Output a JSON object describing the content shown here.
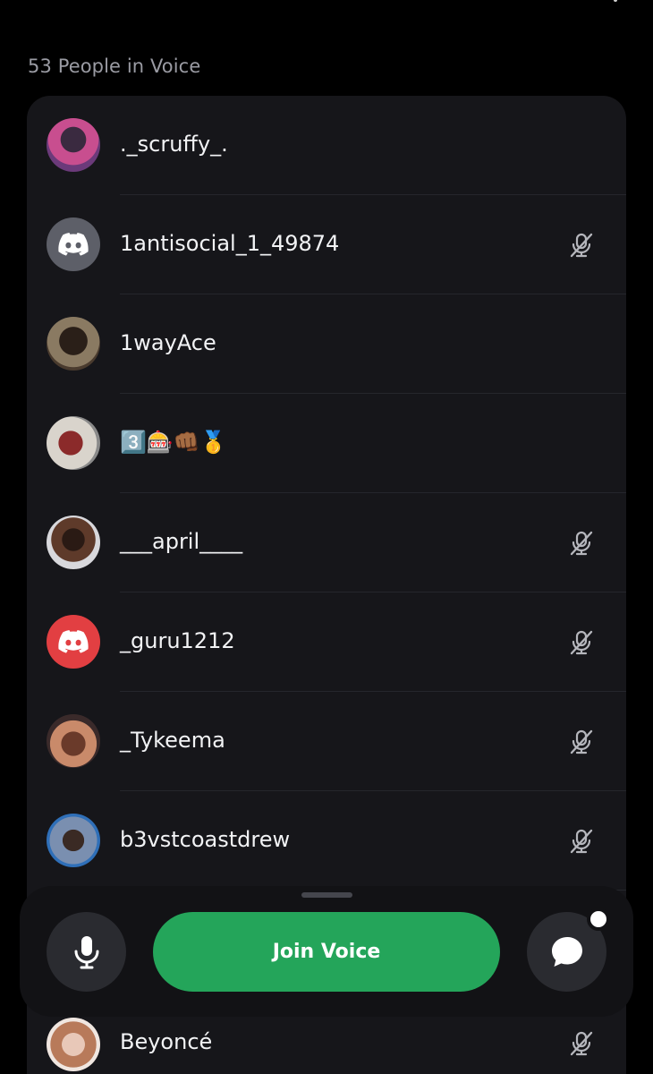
{
  "voice": {
    "header": "53 People in Voice",
    "join_label": "Join Voice"
  },
  "members": [
    {
      "name": "._scruffy_.",
      "avatar": "photo",
      "muted": false
    },
    {
      "name": "1antisocial_1_49874",
      "avatar": "discord-gray",
      "muted": true
    },
    {
      "name": "1wayAce",
      "avatar": "photo",
      "muted": false
    },
    {
      "name": "3️⃣🎰👊🏾🥇",
      "avatar": "photo",
      "muted": false
    },
    {
      "name": "___april____",
      "avatar": "photo",
      "muted": true
    },
    {
      "name": "_guru1212",
      "avatar": "discord-red",
      "muted": true
    },
    {
      "name": "_Tykeema",
      "avatar": "photo",
      "muted": true
    },
    {
      "name": "b3vstcoastdrew",
      "avatar": "photo",
      "muted": true
    },
    {
      "name": "Beyoncé",
      "avatar": "photo",
      "muted": true
    }
  ],
  "colors": {
    "background": "#000000",
    "card": "#16161a",
    "join_green": "#24a55a",
    "discord_gray": "#5d5f68",
    "discord_red": "#e23f42",
    "muted_text": "#9a9ba3"
  },
  "icons": {
    "mute": "mic-off-icon",
    "microphone": "microphone-icon",
    "chat": "chat-bubble-icon",
    "discord": "discord-logo-icon"
  }
}
